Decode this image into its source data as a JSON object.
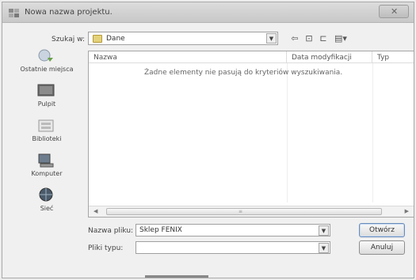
{
  "window": {
    "title": "Nowa nazwa projektu."
  },
  "toolbar": {
    "look_in_label": "Szukaj w:",
    "look_in_value": "Dane",
    "icons": [
      "back-arrow-icon",
      "up-folder-icon",
      "new-folder-icon",
      "view-menu-icon"
    ]
  },
  "places": [
    {
      "label": "Ostatnie miejsca",
      "icon": "recent-places-icon"
    },
    {
      "label": "Pulpit",
      "icon": "desktop-icon"
    },
    {
      "label": "Biblioteki",
      "icon": "libraries-icon"
    },
    {
      "label": "Komputer",
      "icon": "computer-icon"
    },
    {
      "label": "Sieć",
      "icon": "network-icon"
    }
  ],
  "list": {
    "columns": [
      "Nazwa",
      "Data modyfikacji",
      "Typ"
    ],
    "empty_message": "Żadne elementy nie pasują do kryteriów wyszukiwania."
  },
  "form": {
    "filename_label": "Nazwa pliku:",
    "filename_value": "Sklep FENIX",
    "filetype_label": "Pliki typu:",
    "filetype_value": ""
  },
  "buttons": {
    "open": "Otwórz",
    "cancel": "Anuluj"
  },
  "colors": {
    "accent": "#6a8bb8",
    "window_bg": "#f0f0f0"
  }
}
